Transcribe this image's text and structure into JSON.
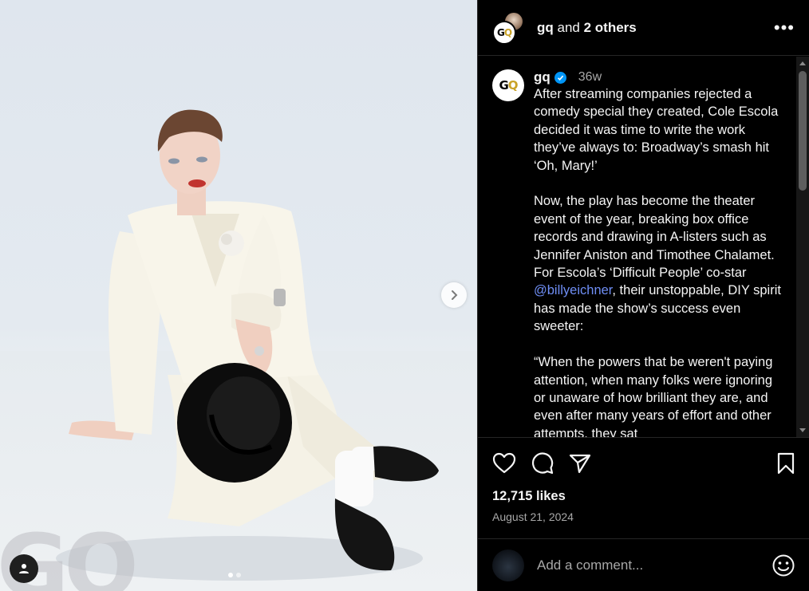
{
  "header": {
    "user": "gq",
    "and_text": "and",
    "others": "2 others",
    "more_label": "•••"
  },
  "brand": {
    "gq_g": "G",
    "gq_q": "Q",
    "gold": "#c9a227"
  },
  "caption": {
    "user": "gq",
    "time_ago": "36w",
    "p1": "After streaming companies rejected a comedy special they created, Cole Escola decided it was time to write the work they’ve always to: Broadway’s smash hit ‘Oh, Mary!’",
    "p2_before": "Now, the play has become the theater event of the year, breaking box office records and drawing in A-listers such as Jennifer Aniston and Timothee Chalamet. For Escola’s ‘Difficult People’ co-star ",
    "mention": "@billyeichner",
    "p2_after": ", their unstoppable, DIY spirit has made the show’s success even sweeter:",
    "p3": "“When the powers that be weren't paying attention, when many folks were ignoring or unaware of how brilliant they are, and even after many years of effort and other attempts, they sat"
  },
  "actions": {
    "likes": "12,715 likes",
    "date": "August 21, 2024",
    "icons": [
      "heart-icon",
      "comment-icon",
      "share-icon",
      "bookmark-icon"
    ]
  },
  "comment": {
    "placeholder": "Add a comment..."
  },
  "photo": {
    "watermark": "GQ",
    "carousel_count": 2,
    "carousel_active": 0
  },
  "colors": {
    "background": "#000000",
    "mention": "#6f8ef5",
    "verified": "#0095f6",
    "muted": "#a8a8a8"
  }
}
